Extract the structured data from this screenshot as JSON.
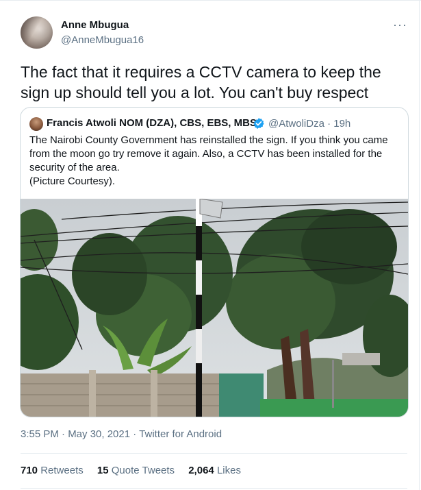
{
  "author": {
    "name": "Anne Mbugua",
    "handle": "@AnneMbugua16"
  },
  "tweet": {
    "text": "The fact that it requires a CCTV camera to keep the sign up should tell you a lot. You can't buy respect"
  },
  "quoted": {
    "name": "Francis Atwoli NOM (DZA), CBS, EBS, MBS.",
    "handle_time": "@AtwoliDza · 19h",
    "text": "The Nairobi County Government has reinstalled the sign. If you think you came from the moon go try remove it again. Also, a CCTV has been installed for the security of the area.",
    "text_line2": "(Picture Courtesy)."
  },
  "meta": {
    "time_date": "3:55 PM · May 30, 2021 · ",
    "source": "Twitter for Android"
  },
  "stats": {
    "retweets_count": "710",
    "retweets_label": "Retweets",
    "quotes_count": "15",
    "quotes_label": "Quote Tweets",
    "likes_count": "2,064",
    "likes_label": "Likes"
  },
  "icons": {
    "more": "more-options-icon",
    "verified": "verified-badge-icon"
  },
  "colors": {
    "text_primary": "#0f1419",
    "text_secondary": "#5b7083",
    "verified_blue": "#1da1f2",
    "border": "#cfd9de"
  }
}
